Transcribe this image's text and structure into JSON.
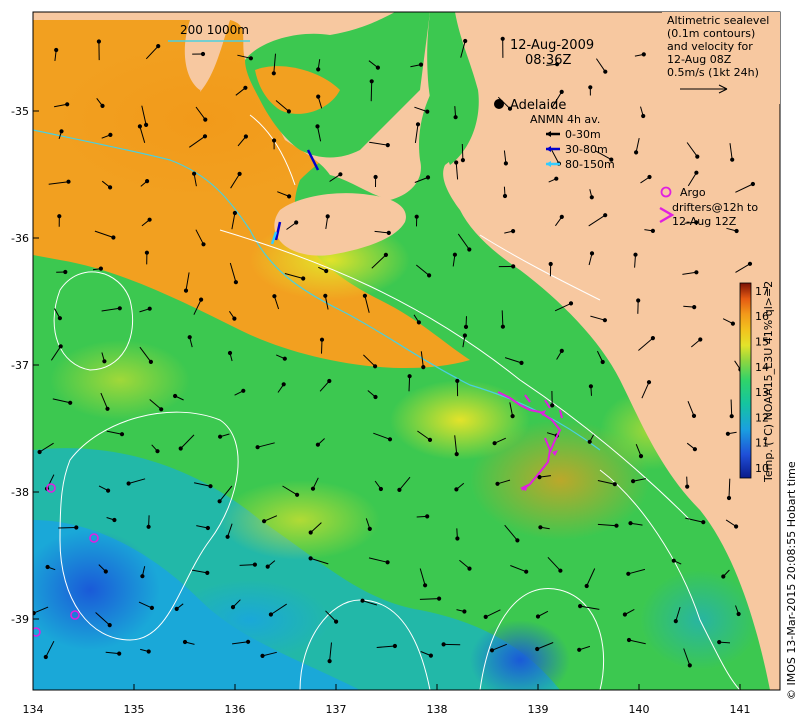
{
  "map": {
    "date": "12-Aug-2009",
    "time": "08:36Z",
    "city": "Adelaide",
    "scale_bar_label": "200  1000m",
    "altimetry_note": [
      "Altimetric sealevel",
      "(0.1m contours)",
      "and velocity for",
      "12-Aug 08Z",
      "0.5m/s (1kt 24h)"
    ],
    "anmn": {
      "title": "ANMN 4h av.",
      "items": [
        {
          "label": "0-30m",
          "color": "#000000"
        },
        {
          "label": "30-80m",
          "color": "#0000cc"
        },
        {
          "label": "80-150m",
          "color": "#33ccff"
        }
      ]
    },
    "argo": {
      "title": "Argo",
      "drifters": [
        "drifters@12h to",
        "12-Aug 12Z"
      ],
      "color": "#e020e0"
    },
    "x_ticks": [
      "134",
      "135",
      "136",
      "137",
      "138",
      "139",
      "140",
      "141"
    ],
    "x_values": [
      134,
      135,
      136,
      137,
      138,
      139,
      140,
      141
    ],
    "y_ticks": [
      "-35",
      "-36",
      "-37",
      "-38",
      "-39"
    ],
    "y_values": [
      -35,
      -36,
      -37,
      -38,
      -39
    ],
    "colorbar": {
      "ticks": [
        "10",
        "11",
        "12",
        "13",
        "14",
        "15",
        "16",
        "17"
      ],
      "values": [
        10,
        11,
        12,
        13,
        14,
        15,
        16,
        17
      ],
      "label": "Temp. (°C) NOAA15_L3U 41% ql>=2",
      "colors": [
        "#0a1a8a",
        "#1f4fd8",
        "#1aa0e0",
        "#15c4a0",
        "#2fd46a",
        "#7ed640",
        "#e3e32a",
        "#f2c21e",
        "#f29a1a",
        "#e55a12",
        "#b81e0a",
        "#7a1005"
      ]
    },
    "credit": "© IMOS 13-Mar-2015 20:08:55 Hobart time"
  },
  "colors": {
    "land": "#f7c8a0",
    "ocean_warm": "#f2a020",
    "ocean_green": "#3cc850",
    "ocean_cold": "#2aa0d0",
    "contour": "#ffffff",
    "shelf": "#4ad0e0"
  }
}
